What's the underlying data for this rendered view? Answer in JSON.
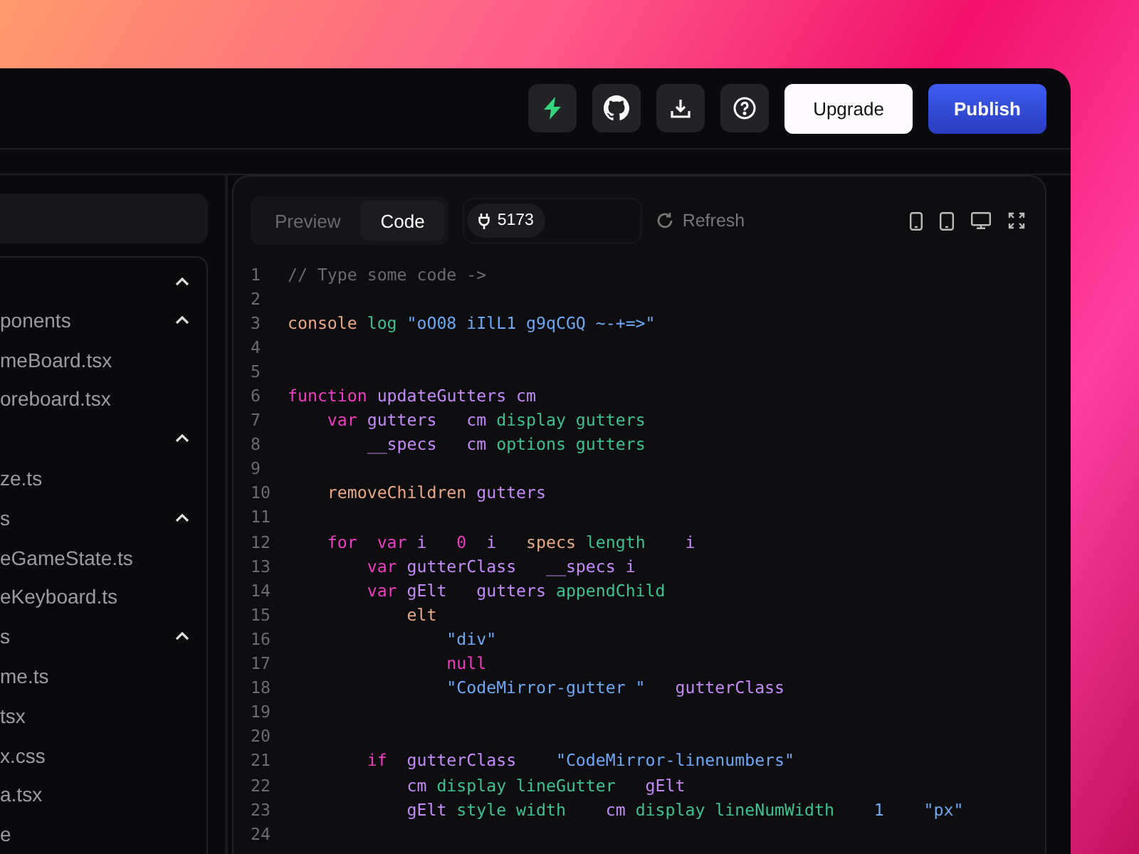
{
  "header": {
    "actions": [
      {
        "kind": "bolt"
      },
      {
        "kind": "github"
      },
      {
        "kind": "download"
      },
      {
        "kind": "help"
      }
    ],
    "buttons": [
      {
        "label": "Upgrade",
        "kind": "secondary"
      },
      {
        "label": "Publish",
        "kind": "primary"
      }
    ]
  },
  "file_tree": [
    {
      "expanded": true,
      "children": [
        {
          "label": "ponents",
          "expanded": true,
          "children": [
            {
              "label": "meBoard.tsx"
            },
            {
              "label": "oreboard.tsx"
            }
          ]
        },
        {
          "expanded": true,
          "children": [
            {
              "label": "ze.ts"
            }
          ]
        },
        {
          "label": "s",
          "expanded": true,
          "children": [
            {
              "label": "eGameState.ts"
            },
            {
              "label": "eKeyboard.ts"
            }
          ]
        },
        {
          "label": "s",
          "expanded": true,
          "children": [
            {
              "label": "me.ts"
            }
          ]
        },
        {
          "label": "tsx"
        },
        {
          "label": "x.css"
        },
        {
          "label": "a.tsx"
        },
        {
          "label": "e"
        }
      ]
    }
  ],
  "toolbar": {
    "tabs": [
      {
        "label": "Preview",
        "selected": false
      },
      {
        "label": "Code",
        "selected": true
      }
    ],
    "port": "5173",
    "refresh": "Refresh",
    "devices": [
      {
        "kind": "phone"
      },
      {
        "kind": "tablet"
      },
      {
        "kind": "desktop"
      },
      {
        "kind": "fullscreen"
      }
    ]
  },
  "code": [
    {
      "number": "1",
      "tokens": [
        {
          "text": "// Type some code ->",
          "kind": "comment"
        }
      ]
    },
    {
      "number": "2"
    },
    {
      "number": "3",
      "tokens": [
        {
          "text": "console ",
          "kind": "func"
        },
        {
          "text": "log ",
          "kind": "prop"
        },
        {
          "text": "\"oO08 iIlL1 g9qCGQ ~-+=>\"",
          "kind": "string"
        }
      ]
    },
    {
      "number": "4"
    },
    {
      "number": "5"
    },
    {
      "number": "6",
      "tokens": [
        {
          "text": "function ",
          "kind": "keyword"
        },
        {
          "text": "updateGutters cm",
          "kind": "var"
        }
      ]
    },
    {
      "number": "7",
      "tokens": [
        {
          "text": "    var ",
          "kind": "keyword"
        },
        {
          "text": "gutters   cm ",
          "kind": "var"
        },
        {
          "text": "display gutters",
          "kind": "prop"
        }
      ]
    },
    {
      "number": "8",
      "tokens": [
        {
          "text": "        __specs   cm ",
          "kind": "var"
        },
        {
          "text": "options gutters",
          "kind": "prop"
        }
      ]
    },
    {
      "number": "9"
    },
    {
      "number": "10",
      "tokens": [
        {
          "text": "    removeChildren ",
          "kind": "func"
        },
        {
          "text": "gutters",
          "kind": "var"
        }
      ]
    },
    {
      "number": "11"
    },
    {
      "number": "12",
      "tokens": [
        {
          "text": "    for  var ",
          "kind": "keyword"
        },
        {
          "text": "i   ",
          "kind": "var"
        },
        {
          "text": "0  ",
          "kind": "keyword"
        },
        {
          "text": "i   ",
          "kind": "var"
        },
        {
          "text": "specs ",
          "kind": "func"
        },
        {
          "text": "length    ",
          "kind": "prop"
        },
        {
          "text": "i",
          "kind": "var"
        }
      ]
    },
    {
      "number": "13",
      "tokens": [
        {
          "text": "        var ",
          "kind": "keyword"
        },
        {
          "text": "gutterClass   __specs i",
          "kind": "var"
        }
      ]
    },
    {
      "number": "14",
      "tokens": [
        {
          "text": "        var ",
          "kind": "keyword"
        },
        {
          "text": "gElt   gutters ",
          "kind": "var"
        },
        {
          "text": "appendChild",
          "kind": "prop"
        }
      ]
    },
    {
      "number": "15",
      "tokens": [
        {
          "text": "            elt",
          "kind": "func"
        }
      ]
    },
    {
      "number": "16",
      "tokens": [
        {
          "text": "                \"div\"",
          "kind": "string"
        }
      ]
    },
    {
      "number": "17",
      "tokens": [
        {
          "text": "                null",
          "kind": "keyword"
        }
      ]
    },
    {
      "number": "18",
      "tokens": [
        {
          "text": "                \"CodeMirror-gutter \"   ",
          "kind": "string"
        },
        {
          "text": "gutterClass",
          "kind": "var"
        }
      ]
    },
    {
      "number": "19"
    },
    {
      "number": "20"
    },
    {
      "number": "21",
      "tokens": [
        {
          "text": "        if  ",
          "kind": "keyword"
        },
        {
          "text": "gutterClass    ",
          "kind": "var"
        },
        {
          "text": "\"CodeMirror-linenumbers\"",
          "kind": "string"
        }
      ]
    },
    {
      "number": "22",
      "tokens": [
        {
          "text": "            cm ",
          "kind": "var"
        },
        {
          "text": "display lineGutter   ",
          "kind": "prop"
        },
        {
          "text": "gElt",
          "kind": "var"
        }
      ]
    },
    {
      "number": "23",
      "tokens": [
        {
          "text": "            gElt ",
          "kind": "var"
        },
        {
          "text": "style width    ",
          "kind": "prop"
        },
        {
          "text": "cm ",
          "kind": "var"
        },
        {
          "text": "display lineNumWidth    ",
          "kind": "prop"
        },
        {
          "text": "1    ",
          "kind": "string"
        },
        {
          "text": "\"px\"",
          "kind": "string"
        }
      ]
    },
    {
      "number": "24"
    }
  ]
}
